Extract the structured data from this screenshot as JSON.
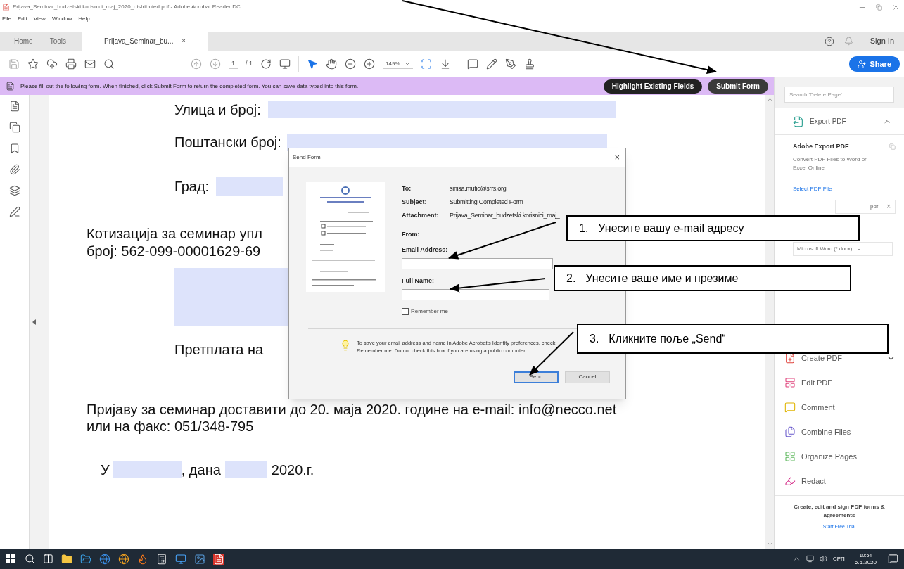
{
  "window": {
    "title": "Prijava_Seminar_budzetski korisnici_maj_2020_distributed.pdf - Adobe Acrobat Reader DC"
  },
  "menu": [
    "File",
    "Edit",
    "View",
    "Window",
    "Help"
  ],
  "tabs": [
    {
      "label": "Home",
      "selected": false
    },
    {
      "label": "Tools",
      "selected": false
    },
    {
      "label": "Prijava_Seminar_bu...",
      "selected": true,
      "close": "×"
    }
  ],
  "account": {
    "sign_in": "Sign In"
  },
  "toolbar": {
    "page": "1",
    "page_total": "/ 1",
    "zoom": "149%",
    "share": "Share"
  },
  "form_bar": {
    "message": "Please fill out the following form. When finished, click Submit Form to return the completed form. You can save data typed into this form.",
    "buttons": [
      "Highlight Existing Fields",
      "Submit Form"
    ]
  },
  "document": {
    "street": "Улица и број:",
    "postal": "Поштански број:",
    "city": "Град:",
    "fee_lines": [
      "Котизација за семинар упл",
      "број: 562-099-00001629-69"
    ],
    "subscription": "Претплата на",
    "submission_lines": [
      "Пријаву за семинар доставити до 20. маја 2020. године на e-mail: info@necco.net",
      "или на факс: 051/348-795"
    ],
    "signature": {
      "place_prefix": "У",
      "date_prefix": ", дана",
      "year": "2020.г."
    }
  },
  "dialog": {
    "title": "Send Form",
    "close": "×",
    "details": [
      {
        "label": "To:",
        "value": "sinisa.mutic@srrs.org"
      },
      {
        "label": "Subject:",
        "value": "Submitting Completed Form"
      },
      {
        "label": "Attachment:",
        "value": "Prijava_Seminar_budzetski korisnici_maj_"
      }
    ],
    "from_label": "From:",
    "email_label": "Email Address:",
    "name_label": "Full Name:",
    "remember": {
      "label": "Remember me",
      "checked": false
    },
    "info": "To save your email address and name in Adobe Acrobat's Identity preferences, check Remember me. Do not check this box if you are using a public computer.",
    "buttons": [
      {
        "label": "Send",
        "default": true
      },
      {
        "label": "Cancel",
        "default": false
      }
    ]
  },
  "right_panel": {
    "search_placeholder": "Search 'Delete Page'",
    "export_header": "Export PDF",
    "export_title": "Adobe Export PDF",
    "export_description": "Convert PDF Files to Word or Excel Online",
    "select_link": "Select PDF File",
    "file_chip": "pdf",
    "file_remove": "×",
    "format": "Microsoft Word (*.docx)",
    "tools": [
      {
        "label": "Create PDF",
        "kind": "create",
        "expandable": true
      },
      {
        "label": "Edit PDF",
        "kind": "edit",
        "expandable": false
      },
      {
        "label": "Comment",
        "kind": "comment",
        "expandable": false
      },
      {
        "label": "Combine Files",
        "kind": "combine",
        "expandable": false
      },
      {
        "label": "Organize Pages",
        "kind": "organize",
        "expandable": false
      },
      {
        "label": "Redact",
        "kind": "redact",
        "expandable": false
      }
    ],
    "promo": "Create, edit and sign PDF forms & agreements",
    "trial_link": "Start Free Trial"
  },
  "callouts": [
    {
      "number": "1.",
      "text": "Унесите вашу e-mail адресу"
    },
    {
      "number": "2.",
      "text": "Унесите ваше име и презиме"
    },
    {
      "number": "3.",
      "text": "Кликните поље „Send“"
    }
  ],
  "taskbar": {
    "language": "СРП",
    "time": "10:54",
    "date": "6.5.2020"
  }
}
